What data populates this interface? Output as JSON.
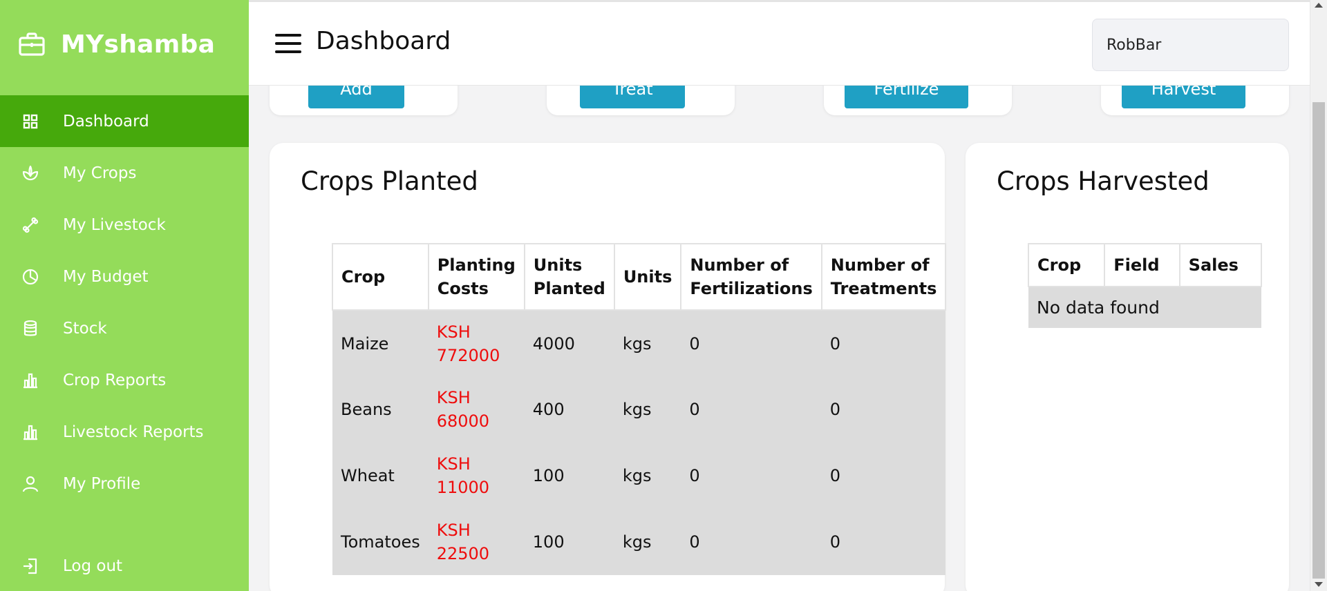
{
  "app": {
    "name": "MYshamba"
  },
  "sidebar": {
    "items": [
      {
        "label": "Dashboard",
        "icon": "grid-icon",
        "active": true
      },
      {
        "label": "My Crops",
        "icon": "sprout-icon"
      },
      {
        "label": "My Livestock",
        "icon": "bone-icon"
      },
      {
        "label": "My Budget",
        "icon": "pie-chart-icon"
      },
      {
        "label": "Stock",
        "icon": "database-icon"
      },
      {
        "label": "Crop Reports",
        "icon": "bar-chart-icon"
      },
      {
        "label": "Livestock Reports",
        "icon": "bar-chart-icon"
      },
      {
        "label": "My Profile",
        "icon": "user-icon"
      }
    ],
    "logout": "Log out"
  },
  "header": {
    "title": "Dashboard",
    "user": "RobBar"
  },
  "actions": {
    "add": "Add",
    "treat": "Treat",
    "fertilize": "Fertilize",
    "harvest": "Harvest"
  },
  "crops_planted": {
    "title": "Crops Planted",
    "columns": [
      "Crop",
      "Planting Costs",
      "Units Planted",
      "Units",
      "Number of Fertilizations",
      "Number of Treatments"
    ],
    "rows": [
      {
        "crop": "Maize",
        "cost_currency": "KSH",
        "cost_amount": "772000",
        "units_planted": "4000",
        "units": "kgs",
        "fertilizations": "0",
        "treatments": "0"
      },
      {
        "crop": "Beans",
        "cost_currency": "KSH",
        "cost_amount": "68000",
        "units_planted": "400",
        "units": "kgs",
        "fertilizations": "0",
        "treatments": "0"
      },
      {
        "crop": "Wheat",
        "cost_currency": "KSH",
        "cost_amount": "11000",
        "units_planted": "100",
        "units": "kgs",
        "fertilizations": "0",
        "treatments": "0"
      },
      {
        "crop": "Tomatoes",
        "cost_currency": "KSH",
        "cost_amount": "22500",
        "units_planted": "100",
        "units": "kgs",
        "fertilizations": "0",
        "treatments": "0"
      }
    ]
  },
  "crops_harvested": {
    "title": "Crops Harvested",
    "columns": [
      "Crop",
      "Field",
      "Sales"
    ],
    "empty": "No data found"
  },
  "colors": {
    "sidebar": "#94dc5a",
    "active": "#46a90c",
    "button": "#1fa0c4",
    "cost": "#ee0d0d"
  }
}
